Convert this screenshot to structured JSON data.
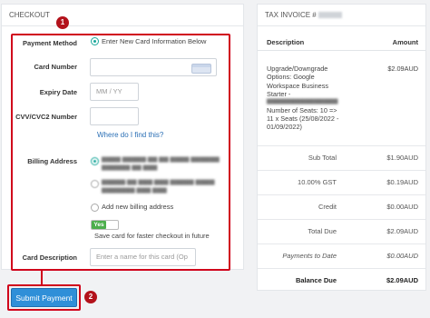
{
  "checkout": {
    "title": "CHECKOUT",
    "payment_method_label": "Payment Method",
    "payment_method_option": "Enter New Card Information Below",
    "card_number_label": "Card Number",
    "expiry_label": "Expiry Date",
    "expiry_placeholder": "MM / YY",
    "cvv_label": "CVV/CVC2 Number",
    "cvv_help_link": "Where do I find this?",
    "billing_label": "Billing Address",
    "billing_add_new": "Add new billing address",
    "toggle_label": "Yes",
    "save_card_text": "Save card for faster checkout in future",
    "card_description_label": "Card Description",
    "card_description_placeholder": "Enter a name for this card (Op",
    "submit_label": "Submit Payment"
  },
  "annotations": {
    "step1": "1",
    "step2": "2"
  },
  "invoice": {
    "title": "TAX INVOICE #",
    "col_description": "Description",
    "col_amount": "Amount",
    "item_line1": "Upgrade/Downgrade",
    "item_line2": "Options: Google",
    "item_line3": "Workspace Business",
    "item_line4": "Starter -",
    "item_line5": "Number of Seats: 10 =>",
    "item_line6": "11 x Seats (25/08/2022 -",
    "item_line7": "01/09/2022)",
    "item_amount": "$2.09AUD",
    "rows": [
      {
        "label": "Sub Total",
        "value": "$1.90AUD"
      },
      {
        "label": "10.00% GST",
        "value": "$0.19AUD"
      },
      {
        "label": "Credit",
        "value": "$0.00AUD"
      },
      {
        "label": "Total Due",
        "value": "$2.09AUD"
      },
      {
        "label": "Payments to Date",
        "value": "$0.00AUD"
      },
      {
        "label": "Balance Due",
        "value": "$2.09AUD"
      }
    ]
  },
  "colors": {
    "accent_red": "#d0021b",
    "primary_blue": "#2f8fd8",
    "radio_teal": "#1aa89b",
    "toggle_green": "#4cae4c"
  }
}
